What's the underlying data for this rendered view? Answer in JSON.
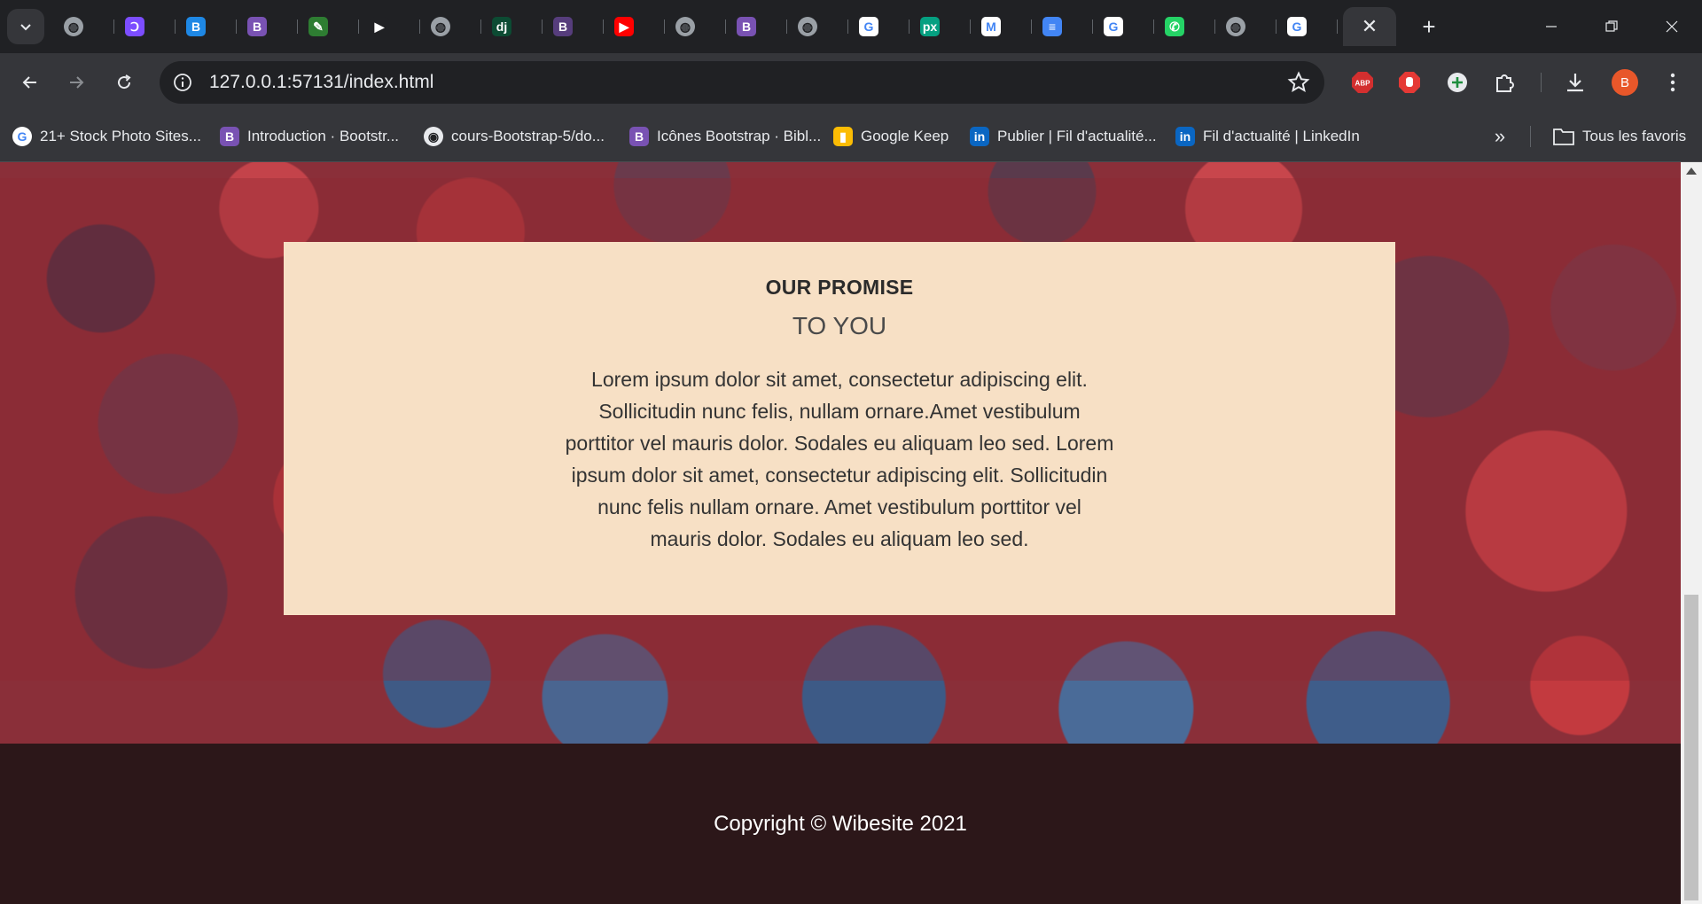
{
  "browser": {
    "tabs": [
      {
        "icon": "globe-icon",
        "color": "#9aa0a6",
        "glyph": "◍"
      },
      {
        "icon": "dribbble-like-icon",
        "color": "#7c4dff",
        "glyph": "Ↄ"
      },
      {
        "icon": "bootstrap-icon",
        "color": "#1e88e5",
        "glyph": "B"
      },
      {
        "icon": "bootstrap-icon",
        "color": "#7952b3",
        "glyph": "B"
      },
      {
        "icon": "pen-icon",
        "color": "#2e7d32",
        "glyph": "✎"
      },
      {
        "icon": "play-icon",
        "color": "#202124",
        "glyph": "▶"
      },
      {
        "icon": "globe-icon",
        "color": "#9aa0a6",
        "glyph": "◍"
      },
      {
        "icon": "django-icon",
        "color": "#0c4b33",
        "glyph": "dj"
      },
      {
        "icon": "bootstrap-icon",
        "color": "#563d7c",
        "glyph": "B"
      },
      {
        "icon": "youtube-icon",
        "color": "#ff0000",
        "glyph": "▶"
      },
      {
        "icon": "globe-icon",
        "color": "#9aa0a6",
        "glyph": "◍"
      },
      {
        "icon": "bootstrap-icon",
        "color": "#7952b3",
        "glyph": "B"
      },
      {
        "icon": "globe-icon",
        "color": "#9aa0a6",
        "glyph": "◍"
      },
      {
        "icon": "google-icon",
        "color": "#ffffff",
        "glyph": "G"
      },
      {
        "icon": "pexels-icon",
        "color": "#05a081",
        "glyph": "px"
      },
      {
        "icon": "gmail-icon",
        "color": "#ffffff",
        "glyph": "M"
      },
      {
        "icon": "docs-icon",
        "color": "#4285f4",
        "glyph": "≡"
      },
      {
        "icon": "google-icon",
        "color": "#ffffff",
        "glyph": "G"
      },
      {
        "icon": "whatsapp-icon",
        "color": "#25d366",
        "glyph": "✆"
      },
      {
        "icon": "globe-icon",
        "color": "#9aa0a6",
        "glyph": "◍"
      },
      {
        "icon": "google-icon",
        "color": "#ffffff",
        "glyph": "G"
      }
    ],
    "url": "127.0.0.1:57131/index.html",
    "profile_initial": "B",
    "bookmarks": [
      {
        "label": "21+ Stock Photo Sites...",
        "icon": "google-icon",
        "glyph": "G",
        "color": "#ffffff"
      },
      {
        "label": "Introduction · Bootstr...",
        "icon": "bootstrap-icon",
        "glyph": "B",
        "color": "#7952b3"
      },
      {
        "label": "cours-Bootstrap-5/do...",
        "icon": "github-icon",
        "glyph": "◉",
        "color": "#35363a"
      },
      {
        "label": "Icônes Bootstrap · Bibl...",
        "icon": "bootstrap-icon",
        "glyph": "B",
        "color": "#7952b3"
      },
      {
        "label": "Google Keep",
        "icon": "keep-icon",
        "glyph": "▮",
        "color": "#fbbc04"
      },
      {
        "label": "Publier | Fil d'actualité...",
        "icon": "linkedin-icon",
        "glyph": "in",
        "color": "#0a66c2"
      },
      {
        "label": "Fil d'actualité | LinkedIn",
        "icon": "linkedin-icon",
        "glyph": "in",
        "color": "#0a66c2"
      }
    ],
    "all_bookmarks_label": "Tous les favoris"
  },
  "page": {
    "promise_title": "OUR PROMISE",
    "promise_subtitle": "TO YOU",
    "promise_text": "Lorem ipsum dolor sit amet, consectetur adipiscing elit. Sollicitudin nunc felis, nullam ornare.Amet vestibulum porttitor vel mauris dolor. Sodales eu aliquam leo sed. Lorem ipsum dolor sit amet, consectetur adipiscing elit. Sollicitudin nunc felis nullam ornare. Amet vestibulum porttitor vel mauris dolor. Sodales eu aliquam leo sed.",
    "copyright": "Copyright © Wibesite 2021"
  },
  "colors": {
    "box_bg": "#f7e0c5",
    "footer_bg": "#2c1719",
    "chrome_dark": "#202124",
    "chrome_toolbar": "#35363a"
  }
}
